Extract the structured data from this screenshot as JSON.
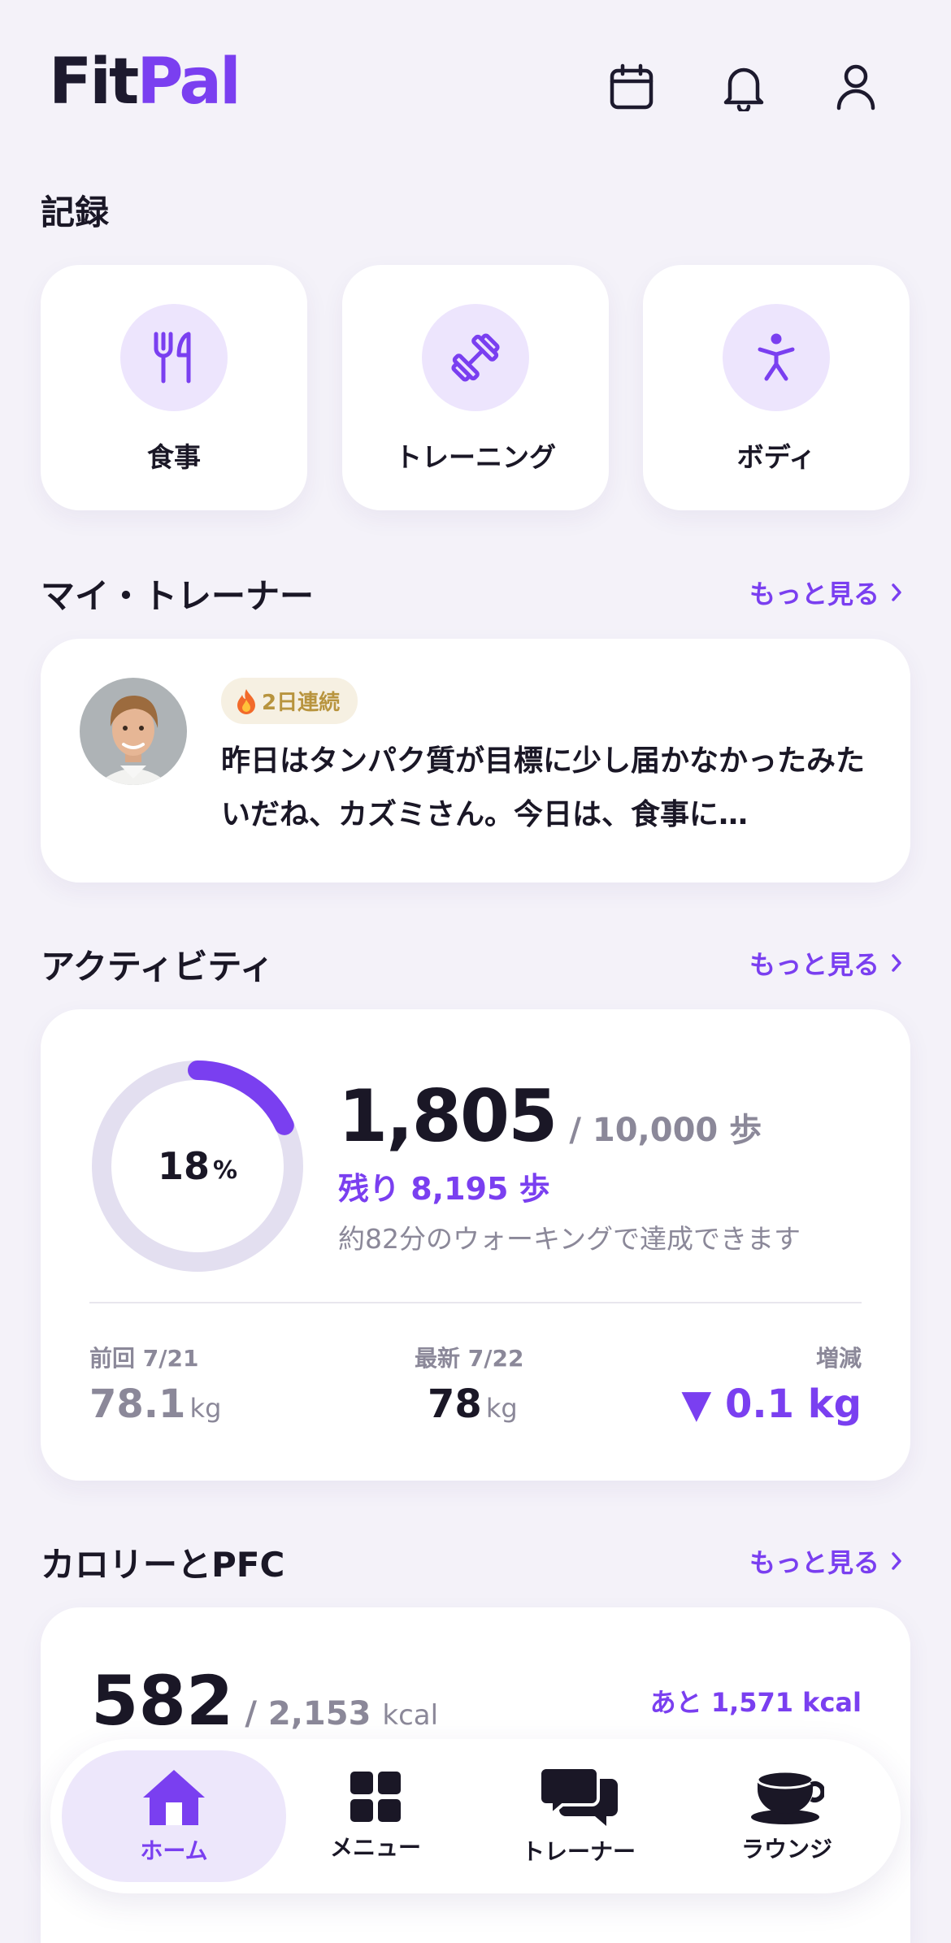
{
  "header": {
    "logo_part1": "Fit",
    "logo_part2": "Pal"
  },
  "record": {
    "title": "記録",
    "tiles": [
      {
        "label": "食事",
        "icon": "fork-knife-icon"
      },
      {
        "label": "トレーニング",
        "icon": "dumbbell-icon"
      },
      {
        "label": "ボディ",
        "icon": "body-icon"
      }
    ]
  },
  "trainer": {
    "title": "マイ・トレーナー",
    "more": "もっと見る",
    "streak": "2日連続",
    "message": "昨日はタンパク質が目標に少し届かなかったみたいだね、カズミさん。今日は、食事に…"
  },
  "activity": {
    "title": "アクティビティ",
    "more": "もっと見る",
    "percent": "18",
    "percent_unit": "%",
    "progress_fraction": 0.18,
    "steps": "1,805",
    "goal": "/ 10,000 歩",
    "remaining": "残り 8,195 歩",
    "hint": "約82分のウォーキングで達成できます",
    "previous_label": "前回 7/21",
    "previous_value": "78.1",
    "latest_label": "最新 7/22",
    "latest_value": "78",
    "change_label": "増減",
    "change_value": "▼ 0.1 kg",
    "unit": "kg"
  },
  "calories": {
    "title": "カロリーとPFC",
    "more": "もっと見る",
    "value": "582",
    "goal": "/ 2,153",
    "goal_unit": "kcal",
    "remaining": "あと 1,571 kcal"
  },
  "nav": {
    "items": [
      {
        "label": "ホーム",
        "icon": "home-icon"
      },
      {
        "label": "メニュー",
        "icon": "grid-icon"
      },
      {
        "label": "トレーナー",
        "icon": "chat-icon"
      },
      {
        "label": "ラウンジ",
        "icon": "coffee-cup-icon"
      }
    ]
  },
  "colors": {
    "accent": "#7a3ff0",
    "background": "#f4f2f9",
    "muted": "#8b8899",
    "streak_bg": "#f6f0e2"
  }
}
